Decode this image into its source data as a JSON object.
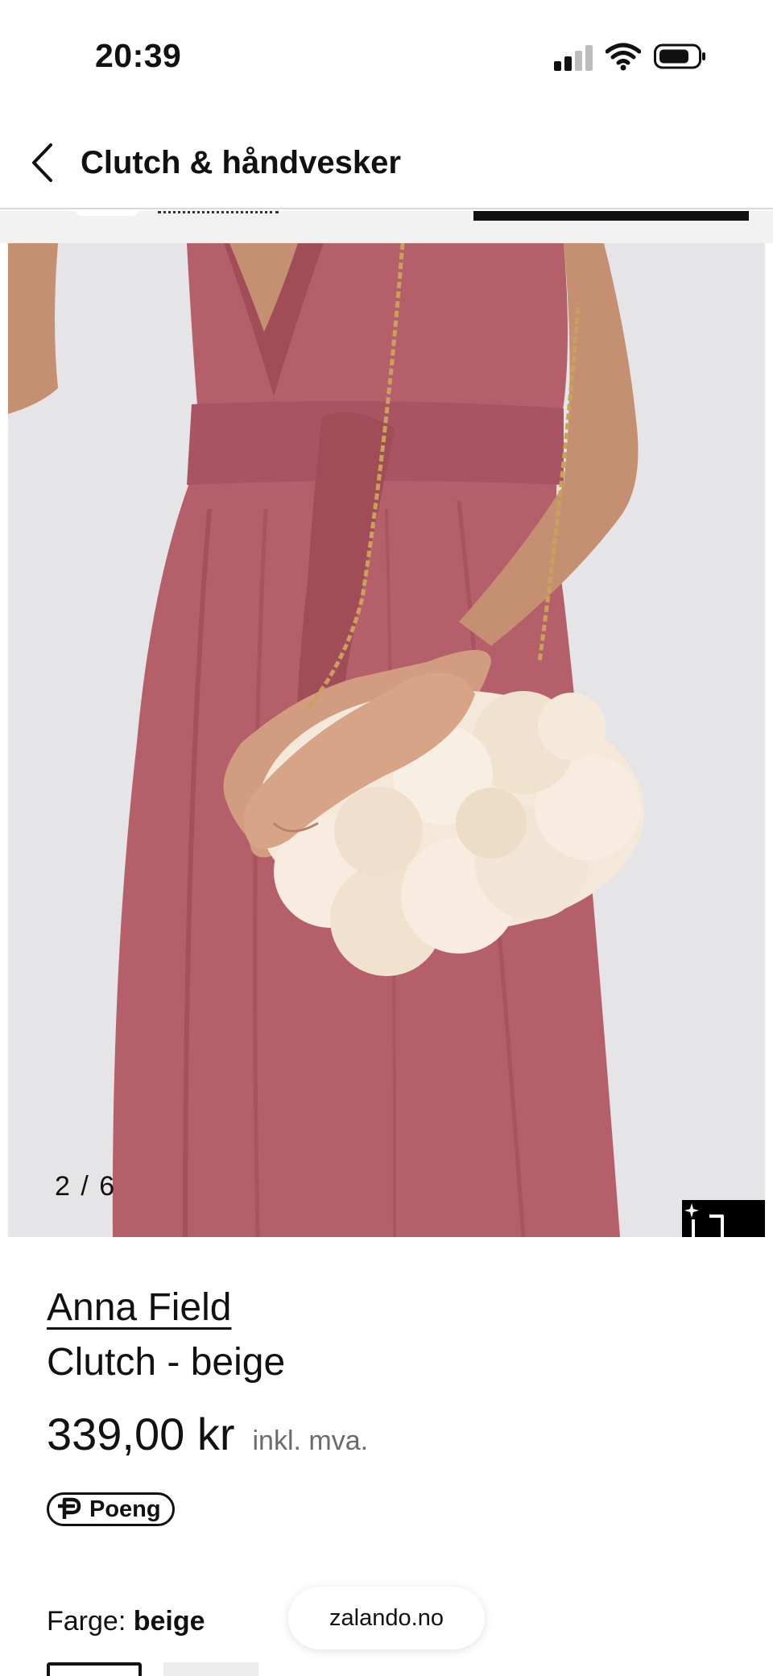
{
  "status_bar": {
    "time": "20:39",
    "icons": [
      "cellular-signal-icon",
      "wifi-icon",
      "battery-icon"
    ]
  },
  "header": {
    "back_icon": "chevron-left-icon",
    "title": "Clutch & håndvesker"
  },
  "gallery": {
    "counter": "2 / 6",
    "similar_button_icon": "similar-items-sparkle-icon",
    "background_color": "#e5e4e6",
    "dress_color": "#b55f6a"
  },
  "product": {
    "brand": "Anna Field",
    "name": "Clutch - beige",
    "price": "339,00 kr",
    "vat_note": "inkl. mva.",
    "points_label": "Poeng",
    "color_label": "Farge:",
    "color_value": "beige"
  },
  "browser": {
    "url": "zalando.no"
  }
}
